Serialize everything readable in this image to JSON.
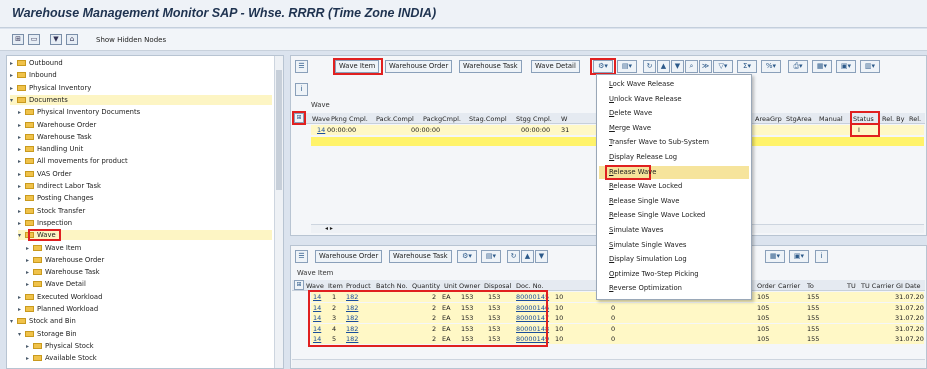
{
  "window": {
    "title": "Warehouse Management Monitor SAP - Whse. RRRR (Time Zone INDIA)"
  },
  "toolbar": {
    "show_hidden_nodes": "Show Hidden Nodes"
  },
  "tree": {
    "items": [
      {
        "label": "Outbound",
        "level": 0,
        "expanded": false
      },
      {
        "label": "Inbound",
        "level": 0,
        "expanded": false
      },
      {
        "label": "Physical Inventory",
        "level": 0,
        "expanded": false
      },
      {
        "label": "Documents",
        "level": 0,
        "expanded": true
      },
      {
        "label": "Physical Inventory Documents",
        "level": 1,
        "expanded": false
      },
      {
        "label": "Warehouse Order",
        "level": 1,
        "expanded": false
      },
      {
        "label": "Warehouse Task",
        "level": 1,
        "expanded": false
      },
      {
        "label": "Handling Unit",
        "level": 1,
        "expanded": false
      },
      {
        "label": "All movements for product",
        "level": 1,
        "expanded": false
      },
      {
        "label": "VAS Order",
        "level": 1,
        "expanded": false
      },
      {
        "label": "Indirect Labor Task",
        "level": 1,
        "expanded": false
      },
      {
        "label": "Posting Changes",
        "level": 1,
        "expanded": false
      },
      {
        "label": "Stock Transfer",
        "level": 1,
        "expanded": false
      },
      {
        "label": "Inspection",
        "level": 1,
        "expanded": false
      },
      {
        "label": "Wave",
        "level": 1,
        "expanded": true
      },
      {
        "label": "Wave Item",
        "level": 2,
        "expanded": false
      },
      {
        "label": "Warehouse Order",
        "level": 2,
        "expanded": false
      },
      {
        "label": "Warehouse Task",
        "level": 2,
        "expanded": false
      },
      {
        "label": "Wave Detail",
        "level": 2,
        "expanded": false
      },
      {
        "label": "Executed Workload",
        "level": 1,
        "expanded": false
      },
      {
        "label": "Planned Workload",
        "level": 1,
        "expanded": false
      },
      {
        "label": "Stock and Bin",
        "level": 0,
        "expanded": true
      },
      {
        "label": "Storage Bin",
        "level": 1,
        "expanded": true
      },
      {
        "label": "Physical Stock",
        "level": 2,
        "expanded": false
      },
      {
        "label": "Available Stock",
        "level": 2,
        "expanded": false
      }
    ]
  },
  "upper": {
    "buttons": {
      "wave_item": "Wave Item",
      "warehouse_order": "Warehouse Order",
      "warehouse_task": "Warehouse Task",
      "wave_detail": "Wave Detail"
    },
    "section_label": "Wave",
    "headers_left": [
      "Wave",
      "Pkng Cmpl.",
      "Pack.Compl",
      "PackgCmpl.",
      "Stag.Compl",
      "Stgg Cmpl.",
      "W"
    ],
    "headers_right": [
      "AreaGrp",
      "StgArea",
      "Manual",
      "Status",
      "Rel. By",
      "Rel."
    ],
    "row": {
      "wave": "14",
      "pkng_cmpl": "00:00:00",
      "packg_cmpl": "00:00:00",
      "stgg_cmpl": "00:00:00",
      "w": "31",
      "status": "I"
    }
  },
  "menu": {
    "items": [
      {
        "u": "L",
        "rest": "ock Wave Release"
      },
      {
        "u": "U",
        "rest": "nlock Wave Release"
      },
      {
        "u": "D",
        "rest": "elete Wave"
      },
      {
        "u": "M",
        "rest": "erge Wave"
      },
      {
        "u": "T",
        "rest": "ransfer Wave to Sub-System"
      },
      {
        "u": "D",
        "rest": "isplay Release Log"
      },
      {
        "u": "R",
        "rest": "elease Wave"
      },
      {
        "u": "R",
        "rest": "elease Wave Locked"
      },
      {
        "u": "R",
        "rest": "elease Single Wave"
      },
      {
        "u": "R",
        "rest": "elease Single Wave Locked"
      },
      {
        "u": "S",
        "rest": "imulate Waves"
      },
      {
        "u": "S",
        "rest": "imulate Single Waves"
      },
      {
        "u": "D",
        "rest": "isplay Simulation Log"
      },
      {
        "u": "O",
        "rest": "ptimize Two-Step Picking"
      },
      {
        "u": "R",
        "rest": "everse Optimization"
      }
    ],
    "highlighted_index": 6
  },
  "lower": {
    "buttons": {
      "warehouse_order": "Warehouse Order",
      "warehouse_task": "Warehouse Task"
    },
    "section_label": "Wave Item",
    "headers_left": [
      "Wave",
      "Item",
      "Product",
      "Batch No.",
      "Quantity",
      "Unit",
      "Owner",
      "Disposal",
      "Doc. No."
    ],
    "headers_right": [
      "Order",
      "Carrier",
      "To",
      "TU",
      "TU Carrier",
      "GI Date"
    ],
    "rows": [
      {
        "wave": "14",
        "item": "1",
        "product": "182",
        "qty": "2",
        "unit": "EA",
        "owner": "153",
        "disposal": "153",
        "doc": "80000145",
        "n": "10",
        "z": "0",
        "order": "105",
        "to": "155",
        "gi": "31.07.20"
      },
      {
        "wave": "14",
        "item": "2",
        "product": "182",
        "qty": "2",
        "unit": "EA",
        "owner": "153",
        "disposal": "153",
        "doc": "80000146",
        "n": "10",
        "z": "0",
        "order": "105",
        "to": "155",
        "gi": "31.07.20"
      },
      {
        "wave": "14",
        "item": "3",
        "product": "182",
        "qty": "2",
        "unit": "EA",
        "owner": "153",
        "disposal": "153",
        "doc": "80000147",
        "n": "10",
        "z": "0",
        "order": "105",
        "to": "155",
        "gi": "31.07.20"
      },
      {
        "wave": "14",
        "item": "4",
        "product": "182",
        "qty": "2",
        "unit": "EA",
        "owner": "153",
        "disposal": "153",
        "doc": "80000148",
        "n": "10",
        "z": "0",
        "order": "105",
        "to": "155",
        "gi": "31.07.20"
      },
      {
        "wave": "14",
        "item": "5",
        "product": "182",
        "qty": "2",
        "unit": "EA",
        "owner": "153",
        "disposal": "153",
        "doc": "80000149",
        "n": "10",
        "z": "0",
        "order": "105",
        "to": "155",
        "gi": "31.07.20"
      }
    ]
  },
  "colors": {
    "highlight_box": "#e02020",
    "selected_row": "#fff8c6",
    "menu_highlight": "#f6e49c",
    "folder": "#f0c24a"
  }
}
